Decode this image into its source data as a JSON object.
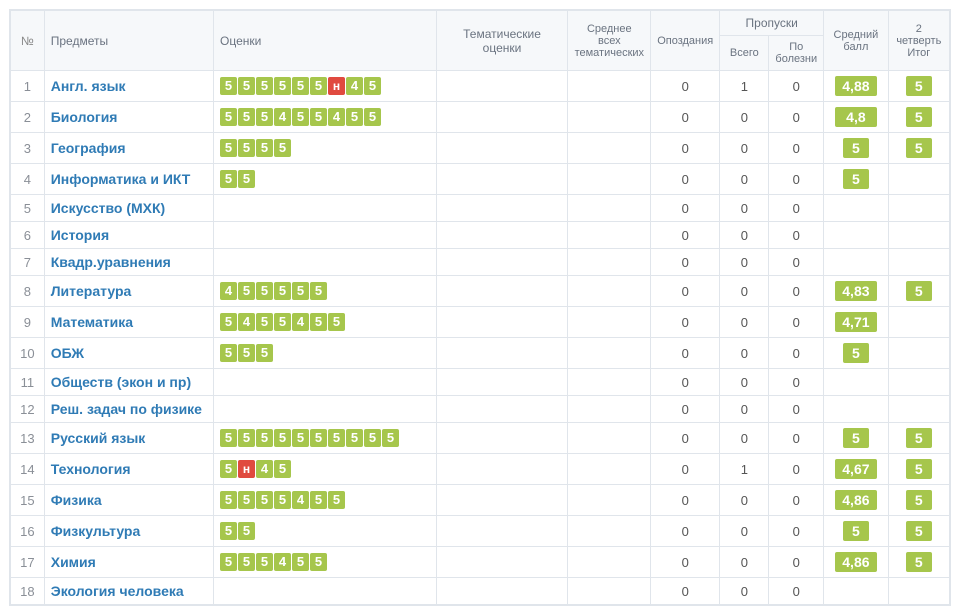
{
  "headers": {
    "num": "№",
    "subjects": "Предметы",
    "grades": "Оценки",
    "thematic": "Тематические оценки",
    "avg_thematic": "Среднее всех тематических",
    "lates": "Опоздания",
    "absences": "Пропуски",
    "abs_total": "Всего",
    "abs_sick": "По болезни",
    "avg": "Средний балл",
    "quarter": "2 четверть Итог"
  },
  "rows": [
    {
      "n": 1,
      "subject": "Англ. язык",
      "grades": [
        "5",
        "5",
        "5",
        "5",
        "5",
        "5",
        "н",
        "4",
        "5"
      ],
      "avg_them": "",
      "late": "0",
      "abs_t": "1",
      "abs_s": "0",
      "avg": "4,88",
      "q": "5"
    },
    {
      "n": 2,
      "subject": "Биология",
      "grades": [
        "5",
        "5",
        "5",
        "4",
        "5",
        "5",
        "4",
        "5",
        "5"
      ],
      "avg_them": "",
      "late": "0",
      "abs_t": "0",
      "abs_s": "0",
      "avg": "4,8",
      "q": "5"
    },
    {
      "n": 3,
      "subject": "География",
      "grades": [
        "5",
        "5",
        "5",
        "5"
      ],
      "avg_them": "",
      "late": "0",
      "abs_t": "0",
      "abs_s": "0",
      "avg": "5",
      "q": "5"
    },
    {
      "n": 4,
      "subject": "Информатика и ИКТ",
      "grades": [
        "5",
        "5"
      ],
      "avg_them": "",
      "late": "0",
      "abs_t": "0",
      "abs_s": "0",
      "avg": "5",
      "q": ""
    },
    {
      "n": 5,
      "subject": "Искусство (МХК)",
      "grades": [],
      "avg_them": "",
      "late": "0",
      "abs_t": "0",
      "abs_s": "0",
      "avg": "",
      "q": ""
    },
    {
      "n": 6,
      "subject": "История",
      "grades": [],
      "avg_them": "",
      "late": "0",
      "abs_t": "0",
      "abs_s": "0",
      "avg": "",
      "q": ""
    },
    {
      "n": 7,
      "subject": "Квадр.уравнения",
      "grades": [],
      "avg_them": "",
      "late": "0",
      "abs_t": "0",
      "abs_s": "0",
      "avg": "",
      "q": ""
    },
    {
      "n": 8,
      "subject": "Литература",
      "grades": [
        "4",
        "5",
        "5",
        "5",
        "5",
        "5"
      ],
      "avg_them": "",
      "late": "0",
      "abs_t": "0",
      "abs_s": "0",
      "avg": "4,83",
      "q": "5"
    },
    {
      "n": 9,
      "subject": "Математика",
      "grades": [
        "5",
        "4",
        "5",
        "5",
        "4",
        "5",
        "5"
      ],
      "avg_them": "",
      "late": "0",
      "abs_t": "0",
      "abs_s": "0",
      "avg": "4,71",
      "q": ""
    },
    {
      "n": 10,
      "subject": "ОБЖ",
      "grades": [
        "5",
        "5",
        "5"
      ],
      "avg_them": "",
      "late": "0",
      "abs_t": "0",
      "abs_s": "0",
      "avg": "5",
      "q": ""
    },
    {
      "n": 11,
      "subject": "Обществ (экон и пр)",
      "grades": [],
      "avg_them": "",
      "late": "0",
      "abs_t": "0",
      "abs_s": "0",
      "avg": "",
      "q": ""
    },
    {
      "n": 12,
      "subject": "Реш. задач по физике",
      "grades": [],
      "avg_them": "",
      "late": "0",
      "abs_t": "0",
      "abs_s": "0",
      "avg": "",
      "q": ""
    },
    {
      "n": 13,
      "subject": "Русский язык",
      "grades": [
        "5",
        "5",
        "5",
        "5",
        "5",
        "5",
        "5",
        "5",
        "5",
        "5"
      ],
      "avg_them": "",
      "late": "0",
      "abs_t": "0",
      "abs_s": "0",
      "avg": "5",
      "q": "5"
    },
    {
      "n": 14,
      "subject": "Технология",
      "grades": [
        "5",
        "н",
        "4",
        "5"
      ],
      "avg_them": "",
      "late": "0",
      "abs_t": "1",
      "abs_s": "0",
      "avg": "4,67",
      "q": "5"
    },
    {
      "n": 15,
      "subject": "Физика",
      "grades": [
        "5",
        "5",
        "5",
        "5",
        "4",
        "5",
        "5"
      ],
      "avg_them": "",
      "late": "0",
      "abs_t": "0",
      "abs_s": "0",
      "avg": "4,86",
      "q": "5"
    },
    {
      "n": 16,
      "subject": "Физкультура",
      "grades": [
        "5",
        "5"
      ],
      "avg_them": "",
      "late": "0",
      "abs_t": "0",
      "abs_s": "0",
      "avg": "5",
      "q": "5"
    },
    {
      "n": 17,
      "subject": "Химия",
      "grades": [
        "5",
        "5",
        "5",
        "4",
        "5",
        "5"
      ],
      "avg_them": "",
      "late": "0",
      "abs_t": "0",
      "abs_s": "0",
      "avg": "4,86",
      "q": "5"
    },
    {
      "n": 18,
      "subject": "Экология человека",
      "grades": [],
      "avg_them": "",
      "late": "0",
      "abs_t": "0",
      "abs_s": "0",
      "avg": "",
      "q": ""
    }
  ]
}
